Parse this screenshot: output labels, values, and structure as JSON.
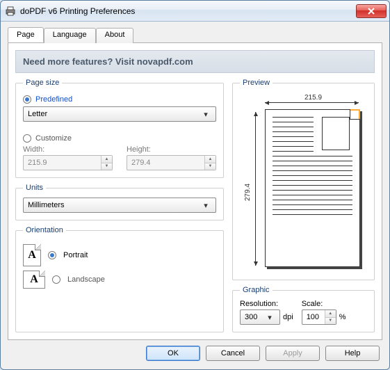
{
  "window": {
    "title": "doPDF v6 Printing Preferences"
  },
  "tabs": {
    "page": "Page",
    "language": "Language",
    "about": "About"
  },
  "banner": "Need more features? Visit novapdf.com",
  "pageSize": {
    "legend": "Page size",
    "predefined": "Predefined",
    "preset": "Letter",
    "customize": "Customize",
    "widthLabel": "Width:",
    "heightLabel": "Height:",
    "width": "215.9",
    "height": "279.4"
  },
  "units": {
    "legend": "Units",
    "value": "Millimeters"
  },
  "orientation": {
    "legend": "Orientation",
    "portrait": "Portrait",
    "landscape": "Landscape"
  },
  "preview": {
    "legend": "Preview",
    "w": "215.9",
    "h": "279.4"
  },
  "graphic": {
    "legend": "Graphic",
    "resLabel": "Resolution:",
    "resValue": "300",
    "dpi": "dpi",
    "scaleLabel": "Scale:",
    "scaleValue": "100",
    "pct": "%"
  },
  "buttons": {
    "ok": "OK",
    "cancel": "Cancel",
    "apply": "Apply",
    "help": "Help"
  }
}
